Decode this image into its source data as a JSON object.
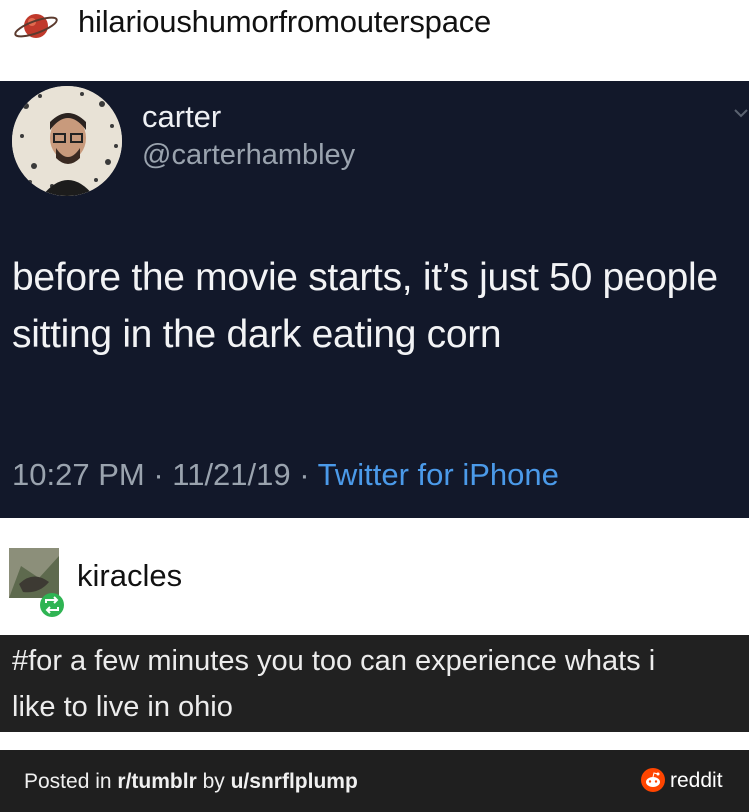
{
  "op_post": {
    "username": "hilarioushumorfromouterspace",
    "avatar_icon": "planet-icon"
  },
  "tweet": {
    "display_name": "carter",
    "handle": "@carterhambley",
    "text": "before the movie starts, it’s just 50 people sitting in the dark eating corn",
    "time": "10:27 PM",
    "date": "11/21/19",
    "source": "Twitter for iPhone",
    "separator": " · ",
    "colors": {
      "background": "#12182a",
      "source_link": "#4b9ae9"
    }
  },
  "reblog": {
    "username": "kiracles",
    "badge_icon": "reblog-icon",
    "tags_line1": "#for a few minutes you too can experience whats i",
    "tags_line2": "like to live in ohio"
  },
  "footer": {
    "posted_in": "Posted in ",
    "subreddit": "r/tumblr",
    "by": " by ",
    "user": "u/snrflplump",
    "brand": "reddit",
    "brand_icon": "reddit-logo-icon",
    "brand_color": "#ff4500"
  }
}
